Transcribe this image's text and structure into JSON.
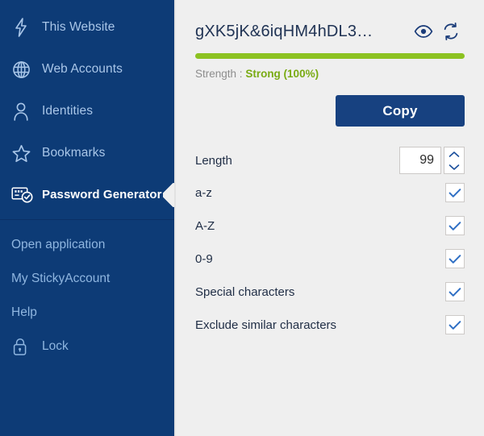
{
  "sidebar": {
    "items": [
      {
        "label": "This Website",
        "icon": "bolt-icon",
        "active": false
      },
      {
        "label": "Web Accounts",
        "icon": "globe-icon",
        "active": false
      },
      {
        "label": "Identities",
        "icon": "person-icon",
        "active": false
      },
      {
        "label": "Bookmarks",
        "icon": "star-icon",
        "active": false
      },
      {
        "label": "Password Generator",
        "icon": "password-card-icon",
        "active": true
      }
    ],
    "links": [
      {
        "label": "Open application",
        "icon": null
      },
      {
        "label": "My StickyAccount",
        "icon": null
      },
      {
        "label": "Help",
        "icon": null
      },
      {
        "label": "Lock",
        "icon": "lock-icon"
      }
    ]
  },
  "main": {
    "password": "gXK5jK&6iqHM4hDL3…",
    "reveal_icon": "eye-icon",
    "regenerate_icon": "refresh-icon",
    "strength": {
      "label": "Strength :",
      "value": "Strong (100%)",
      "percent": 100,
      "bar_color": "#8cc221",
      "text_color": "#79ab13"
    },
    "copy_label": "Copy",
    "length": {
      "label": "Length",
      "value": "99"
    },
    "options": [
      {
        "label": "a-z",
        "checked": true
      },
      {
        "label": "A-Z",
        "checked": true
      },
      {
        "label": "0-9",
        "checked": true
      },
      {
        "label": "Special characters",
        "checked": true
      },
      {
        "label": "Exclude similar characters",
        "checked": true
      }
    ]
  },
  "colors": {
    "sidebar_bg": "#0d3b76",
    "panel_bg": "#efefef",
    "accent": "#174180",
    "sidebar_text": "#a9c6e8"
  }
}
